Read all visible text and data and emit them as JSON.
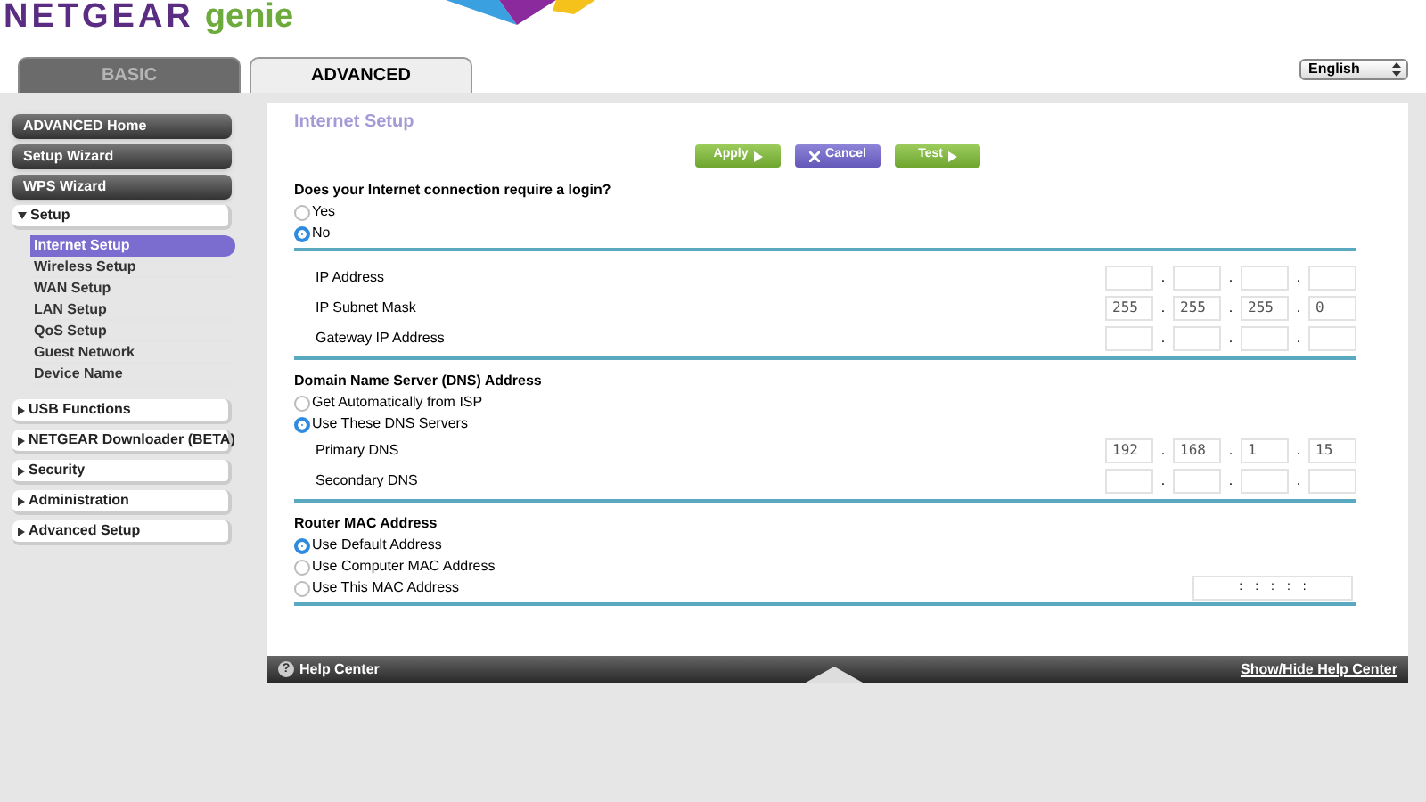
{
  "header": {
    "brand": "NETGEAR",
    "product": "genie",
    "language": "English"
  },
  "tabs": [
    {
      "label": "BASIC",
      "selected": false
    },
    {
      "label": "ADVANCED",
      "selected": true
    }
  ],
  "sidebar": {
    "items": [
      {
        "label": "ADVANCED Home",
        "kind": "button"
      },
      {
        "label": "Setup Wizard",
        "kind": "button"
      },
      {
        "label": "WPS Wizard",
        "kind": "button"
      },
      {
        "label": "Setup",
        "kind": "section",
        "expanded": true,
        "children": [
          {
            "label": "Internet Setup",
            "selected": true
          },
          {
            "label": "Wireless Setup",
            "selected": false
          },
          {
            "label": "WAN Setup",
            "selected": false
          },
          {
            "label": "LAN Setup",
            "selected": false
          },
          {
            "label": "QoS Setup",
            "selected": false
          },
          {
            "label": "Guest Network",
            "selected": false
          },
          {
            "label": "Device Name",
            "selected": false
          }
        ]
      },
      {
        "label": "USB Functions",
        "kind": "section",
        "expanded": false
      },
      {
        "label": "NETGEAR Downloader (BETA)",
        "kind": "section",
        "expanded": false
      },
      {
        "label": "Security",
        "kind": "section",
        "expanded": false
      },
      {
        "label": "Administration",
        "kind": "section",
        "expanded": false
      },
      {
        "label": "Advanced Setup",
        "kind": "section",
        "expanded": false
      }
    ]
  },
  "content": {
    "title": "Internet Setup",
    "buttons": [
      {
        "label": "Apply",
        "kind": "apply"
      },
      {
        "label": "Cancel",
        "kind": "cancel"
      },
      {
        "label": "Test",
        "kind": "test"
      }
    ],
    "sections": [
      {
        "heading": "Does your Internet connection require a login?",
        "options": [
          {
            "label": "Yes",
            "selected": false
          },
          {
            "label": "No",
            "selected": true
          }
        ]
      },
      {
        "fields": [
          {
            "label": "IP Address",
            "separator": "."
          },
          {
            "label": "IP Subnet Mask",
            "separator": ".",
            "values": [
              "255",
              "255",
              "255",
              "0"
            ]
          },
          {
            "label": "Gateway IP Address",
            "separator": "."
          }
        ]
      },
      {
        "heading": "Domain Name Server (DNS) Address",
        "options": [
          {
            "label": "Get Automatically from ISP",
            "selected": false
          },
          {
            "label": "Use These DNS Servers",
            "selected": true
          }
        ],
        "fields": [
          {
            "label": "Primary DNS",
            "separator": ".",
            "values": [
              "192",
              "168",
              "1",
              "15"
            ]
          },
          {
            "label": "Secondary DNS",
            "separator": "."
          }
        ]
      },
      {
        "heading": "Router MAC Address",
        "options": [
          {
            "label": "Use Default Address",
            "selected": true
          },
          {
            "label": "Use Computer MAC Address",
            "selected": false
          },
          {
            "label": "Use This MAC Address",
            "selected": false,
            "mac_separator": ":"
          }
        ]
      }
    ]
  },
  "help_bar": {
    "icon": "?",
    "label": "Help Center",
    "toggle": "Show/Hide Help Center"
  }
}
